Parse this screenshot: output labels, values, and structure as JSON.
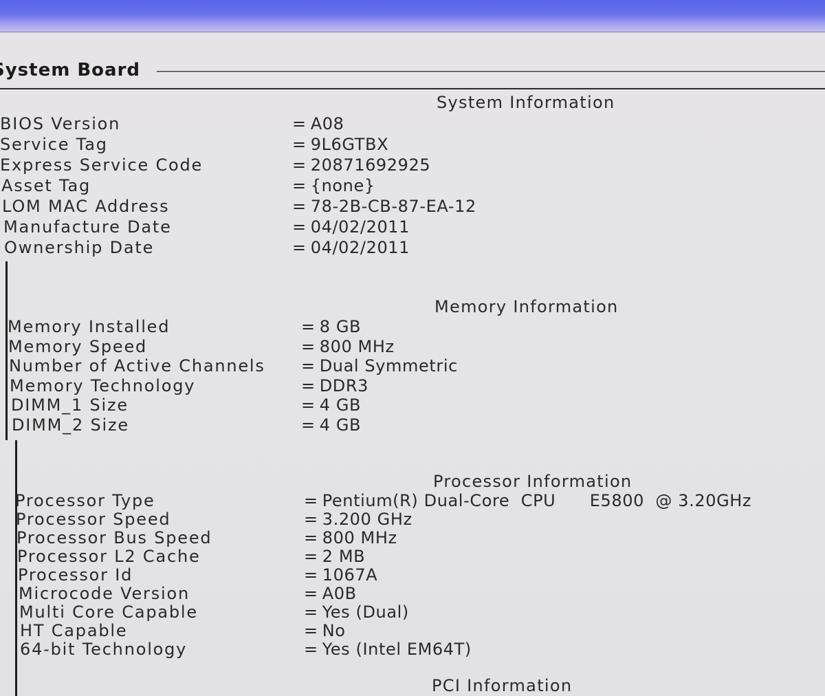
{
  "window": {
    "group_title": "System Board"
  },
  "sections": {
    "system": {
      "title": "System Information",
      "rows": [
        {
          "label": "BIOS Version",
          "value": "A08"
        },
        {
          "label": "Service Tag",
          "value": "9L6GTBX"
        },
        {
          "label": "Express Service Code",
          "value": "20871692925"
        },
        {
          "label": "Asset Tag",
          "value": "{none}"
        },
        {
          "label": "LOM MAC Address",
          "value": "78-2B-CB-87-EA-12"
        },
        {
          "label": "Manufacture Date",
          "value": "04/02/2011"
        },
        {
          "label": "Ownership Date",
          "value": "04/02/2011"
        }
      ]
    },
    "memory": {
      "title": "Memory Information",
      "rows": [
        {
          "label": "Memory Installed",
          "value": "8 GB"
        },
        {
          "label": "Memory Speed",
          "value": "800 MHz"
        },
        {
          "label": "Number of Active Channels",
          "value": "Dual Symmetric"
        },
        {
          "label": "Memory Technology",
          "value": "DDR3"
        },
        {
          "label": "DIMM_1 Size",
          "value": "4 GB"
        },
        {
          "label": "DIMM_2 Size",
          "value": "4 GB"
        }
      ]
    },
    "processor": {
      "title": "Processor Information",
      "rows": [
        {
          "label": "Processor Type",
          "value": "Pentium(R) Dual-Core  CPU      E5800  @ 3.20GHz"
        },
        {
          "label": "Processor Speed",
          "value": "3.200 GHz"
        },
        {
          "label": "Processor Bus Speed",
          "value": "800 MHz"
        },
        {
          "label": "Processor L2 Cache",
          "value": "2 MB"
        },
        {
          "label": "Processor Id",
          "value": "1067A"
        },
        {
          "label": "Microcode Version",
          "value": "A0B"
        },
        {
          "label": "Multi Core Capable",
          "value": "Yes (Dual)"
        },
        {
          "label": "HT Capable",
          "value": "No"
        },
        {
          "label": "64-bit Technology",
          "value": "Yes (Intel EM64T)"
        }
      ]
    },
    "pci": {
      "title": "PCI Information"
    }
  },
  "separator": "="
}
